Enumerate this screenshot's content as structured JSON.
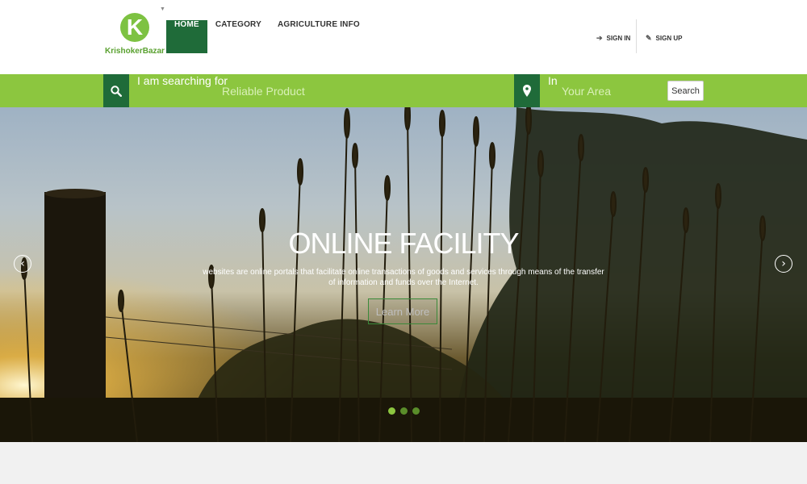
{
  "brand": {
    "letter": "K",
    "name": "KrishokerBazar",
    "color": "#7dc242"
  },
  "nav": {
    "items": [
      {
        "label": "HOME",
        "active": true
      },
      {
        "label": "CATEGORY",
        "active": false
      },
      {
        "label": "AGRICULTURE INFO",
        "active": false
      }
    ]
  },
  "auth": {
    "signin_label": "SIGN IN",
    "signup_label": "SIGN UP",
    "signin_icon": "signin-icon",
    "signup_icon": "edit-icon"
  },
  "search": {
    "label": "I am searching for",
    "placeholder": "Reliable Product",
    "location_label": "In",
    "location_placeholder": "Your Area",
    "button_label": "Search",
    "bar_color": "#8cc63f",
    "icon_bg": "#1f6b39"
  },
  "hero": {
    "title": "ONLINE FACILITY",
    "subtitle": "websites are online portals that facilitate online transactions of goods and services through means of the transfer of information and funds over the Internet.",
    "button_label": "Learn More",
    "prev_label": "‹",
    "next_label": "›",
    "slides": 3,
    "active_slide": 1
  }
}
